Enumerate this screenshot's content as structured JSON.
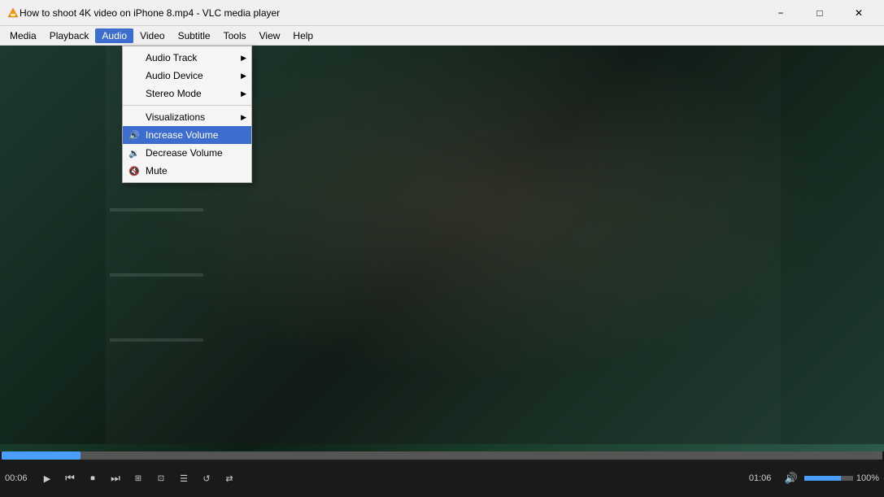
{
  "window": {
    "title": "How to shoot 4K video on iPhone 8.mp4 - VLC media player",
    "min_label": "−",
    "max_label": "□",
    "close_label": "✕"
  },
  "menubar": {
    "items": [
      {
        "id": "media",
        "label": "Media"
      },
      {
        "id": "playback",
        "label": "Playback"
      },
      {
        "id": "audio",
        "label": "Audio"
      },
      {
        "id": "video",
        "label": "Video"
      },
      {
        "id": "subtitle",
        "label": "Subtitle"
      },
      {
        "id": "tools",
        "label": "Tools"
      },
      {
        "id": "view",
        "label": "View"
      },
      {
        "id": "help",
        "label": "Help"
      }
    ]
  },
  "audio_menu": {
    "items": [
      {
        "id": "audio-track",
        "label": "Audio Track",
        "has_sub": true,
        "icon": ""
      },
      {
        "id": "audio-device",
        "label": "Audio Device",
        "has_sub": true,
        "icon": ""
      },
      {
        "id": "stereo-mode",
        "label": "Stereo Mode",
        "has_sub": true,
        "icon": ""
      },
      {
        "id": "sep1",
        "type": "separator"
      },
      {
        "id": "visualizations",
        "label": "Visualizations",
        "has_sub": true,
        "icon": ""
      },
      {
        "id": "increase-volume",
        "label": "Increase Volume",
        "highlighted": true,
        "icon": "speaker-up"
      },
      {
        "id": "decrease-volume",
        "label": "Decrease Volume",
        "icon": "speaker-down"
      },
      {
        "id": "mute",
        "label": "Mute",
        "icon": "mute"
      }
    ]
  },
  "player": {
    "time_current": "00:06",
    "time_total": "01:06",
    "progress_percent": 9,
    "volume_percent": 100,
    "volume_label": "100%"
  },
  "controls": {
    "play_label": "▶",
    "prev_chapter": "⏮",
    "stop": "⏹",
    "next_chapter": "⏭",
    "toggle_playlist": "☰",
    "extended": "⊞",
    "playlist": "≡",
    "loop": "↺",
    "random": "⇄",
    "frame_by_frame": "⊡",
    "fullscreen": "⛶",
    "volume_icon": "🔊"
  }
}
